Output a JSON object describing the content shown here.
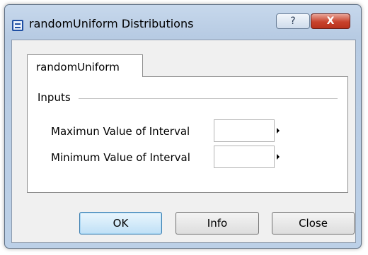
{
  "window": {
    "title": "randomUniform Distributions",
    "help_label": "?",
    "close_label": "X"
  },
  "tabs": [
    {
      "label": "randomUniform",
      "selected": true
    }
  ],
  "inputs_group": {
    "label": "Inputs",
    "fields": [
      {
        "label": "Maximun Value of Interval",
        "value": ""
      },
      {
        "label": "Minimum Value of Interval",
        "value": ""
      }
    ]
  },
  "buttons": {
    "ok": "OK",
    "info": "Info",
    "close": "Close"
  },
  "colors": {
    "titlebar": "#b7cbe3",
    "close_button": "#c8422c",
    "ok_button_border": "#3c7fb1"
  }
}
